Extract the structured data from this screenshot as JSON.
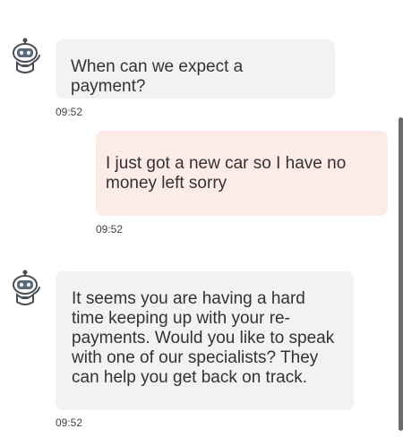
{
  "chat": {
    "messages": [
      {
        "sender": "bot",
        "text": "When can we expect a payment?",
        "time": "09:52"
      },
      {
        "sender": "user",
        "text": "I just got a new car so I have no money left sorry",
        "time": "09:52"
      },
      {
        "sender": "bot",
        "text": "It seems you are having a hard time keeping up with your re-payments. Would you like to speak with one of our specialists? They can help you get back on track.",
        "time": "09:52"
      }
    ]
  },
  "icons": {
    "bot_avatar": "robot-icon"
  },
  "colors": {
    "bot_bubble": "#f2f2f2",
    "user_bubble": "#fdebe7",
    "scrollbar": "#6b6b6b"
  }
}
